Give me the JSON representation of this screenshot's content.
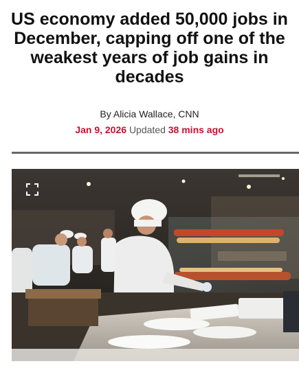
{
  "article": {
    "headline": "US economy added 50,000 jobs in December, capping off one of the weakest years of job gains in decades",
    "byline": "By Alicia Wallace, CNN",
    "date": "Jan 9, 2026",
    "updated_label": "Updated",
    "updated_time": "38 mins ago"
  },
  "image": {
    "icon": "expand-icon"
  },
  "colors": {
    "accent": "#c8102e",
    "divider": "#666666"
  }
}
